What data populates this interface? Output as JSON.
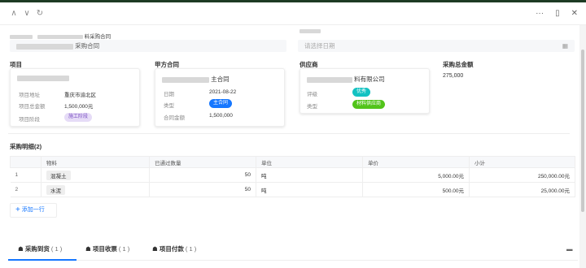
{
  "window": {
    "nav_icons": [
      "chevron-up-icon",
      "chevron-down-icon",
      "refresh-icon"
    ],
    "toolbar_icons": [
      "more-icon",
      "panel-icon",
      "close-icon"
    ],
    "nav_up": "∧",
    "nav_down": "∨",
    "nav_refresh": "↻",
    "more": "···",
    "panel": "▯",
    "close": "✕"
  },
  "header": {
    "top_label_tail": "料采购合同",
    "contract_name_tail": "采购合同",
    "date_placeholder": "请选择日期",
    "calendar_icon": "▦"
  },
  "sections": {
    "project": "项目",
    "party_a": "甲方合同",
    "supplier": "供应商",
    "total": "采购总金额",
    "total_value": "275,000"
  },
  "project_card": {
    "rows": [
      {
        "k": "项目地址",
        "v": "重庆市渝北区"
      },
      {
        "k": "项目总金额",
        "v": "1,500,000元"
      },
      {
        "k": "项目阶段",
        "v": "施工阶段"
      }
    ],
    "stage_color": "#e6dcf7"
  },
  "contract_card": {
    "title_tail": "主合同",
    "rows": [
      {
        "k": "日期",
        "v": "2021-08-22"
      },
      {
        "k": "类型",
        "v": "主合同"
      },
      {
        "k": "合同金额",
        "v": "1,500,000"
      }
    ],
    "type_color": "#1677ff"
  },
  "supplier_card": {
    "title_tail": "料有限公司",
    "rows": [
      {
        "k": "评级",
        "v": "优秀"
      },
      {
        "k": "类型",
        "v": "材料供应商"
      }
    ],
    "rating_color": "#13c2c2",
    "type_color": "#52c41a"
  },
  "details": {
    "title": "采购明细(2)",
    "columns": [
      "物料",
      "已通过数量",
      "单位",
      "单价",
      "小计"
    ],
    "rows": [
      {
        "idx": "1",
        "material": "混凝土",
        "qty": "50",
        "unit": "吨",
        "price": "5,000.00元",
        "subtotal": "250,000.00元"
      },
      {
        "idx": "2",
        "material": "水泥",
        "qty": "50",
        "unit": "吨",
        "price": "500.00元",
        "subtotal": "25,000.00元"
      }
    ],
    "add_label": "添加一行"
  },
  "tabs": [
    {
      "label": "采购到货",
      "count": "( 1 )"
    },
    {
      "label": "项目收票",
      "count": "( 1 )"
    },
    {
      "label": "项目付款",
      "count": "( 1 )"
    }
  ],
  "tab_icon": "☗",
  "collapse_icon": "▬"
}
